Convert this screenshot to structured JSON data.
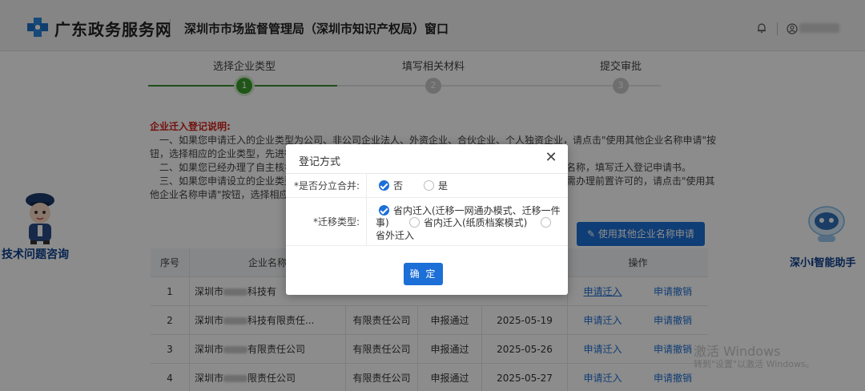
{
  "header": {
    "site_title": "广东政务服务网",
    "dept_title": "深圳市市场监督管理局（深圳市知识产权局）窗口"
  },
  "steps": [
    {
      "label": "选择企业类型",
      "number": "1",
      "active": true
    },
    {
      "label": "填写相关材料",
      "number": "2",
      "active": false
    },
    {
      "label": "提交审批",
      "number": "3",
      "active": false
    }
  ],
  "notes": {
    "title": "企业迁入登记说明:",
    "line1": "一、如果您申请迁入的企业类型为公司、非公司企业法人、外资企业、合伙企业、个人独资企业，请点击\"使用其他企业名称申请\"按",
    "line2": "钮，选择相应的企业类型，先进行",
    "line3": "二、如果您已经办理了自主核名",
    "line3b": "名称，填写迁入登记申请书。",
    "line4": "三、如果您申请设立的企业类型",
    "line4b": "需办理前置许可的，请点击\"使用其",
    "line5": "他企业名称申请\"按钮，选择相应"
  },
  "side": {
    "left_label": "技术问题咨询",
    "right_label": "深小i智能助手"
  },
  "other_name_button": "使用其他企业名称申请",
  "table": {
    "headers": [
      "序号",
      "企业名称",
      "",
      "",
      "",
      "操作"
    ],
    "rows": [
      {
        "no": "1",
        "name": "深圳市",
        "name_tail": "科技有",
        "type": "",
        "status": "",
        "date": "",
        "action1": "申请迁入",
        "action2": "申请撤销"
      },
      {
        "no": "2",
        "name": "深圳市",
        "name_tail": "科技有限责任...",
        "type": "有限责任公司",
        "status": "申报通过",
        "date": "2025-05-19",
        "action1": "申请迁入",
        "action2": "申请撤销"
      },
      {
        "no": "3",
        "name": "深圳市",
        "name_tail": "有限责任公司",
        "type": "有限责任公司",
        "status": "申报通过",
        "date": "2025-05-26",
        "action1": "申请迁入",
        "action2": "申请撤销"
      },
      {
        "no": "4",
        "name": "深圳市",
        "name_tail": "限责任公司",
        "type": "有限责任公司",
        "status": "申报通过",
        "date": "2025-05-27",
        "action1": "申请迁入",
        "action2": "申请撤销"
      }
    ]
  },
  "watermark": {
    "line1": "激活 Windows",
    "line2": "转到\"设置\"以激活 Windows。"
  },
  "dialog": {
    "title": "登记方式",
    "close": "✕",
    "q1_label": "*是否分立合并:",
    "q1_options": [
      {
        "label": "否",
        "selected": true
      },
      {
        "label": "是",
        "selected": false
      }
    ],
    "q2_label": "*迁移类型:",
    "q2_opt1_line1": "省内迁入(迁移一网通办模式、迁移一件",
    "q2_opt1_line2": "事)",
    "q2_opt2": "省内迁入(纸质档案模式)",
    "q2_opt3": "省外迁入",
    "ok_button": "确 定"
  }
}
